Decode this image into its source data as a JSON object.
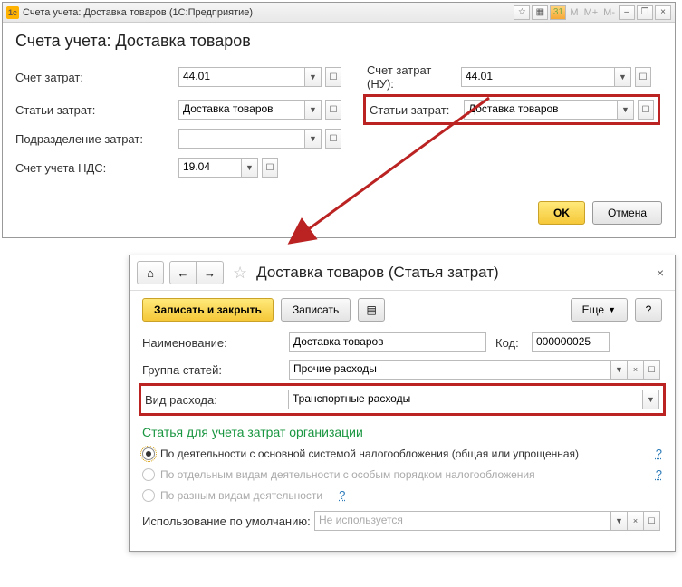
{
  "win1": {
    "titlebar": "Счета учета: Доставка товаров  (1С:Предприятие)",
    "tb_icon": "1c",
    "header": "Счета учета: Доставка товаров",
    "labels": {
      "cost_account": "Счет затрат:",
      "cost_items": "Статьи затрат:",
      "department": "Подразделение затрат:",
      "vat_account": "Счет учета НДС:",
      "cost_account_nu": "Счет затрат (НУ):",
      "cost_items_r": "Статьи затрат:"
    },
    "values": {
      "cost_account": "44.01",
      "cost_items": "Доставка товаров",
      "department": "",
      "vat_account": "19.04",
      "cost_account_nu": "44.01",
      "cost_items_r": "Доставка товаров"
    },
    "ok": "OK",
    "cancel": "Отмена",
    "top_buttons": {
      "m": "M",
      "mplus": "M+",
      "mminus": "M-"
    }
  },
  "win2": {
    "title": "Доставка товаров (Статья затрат)",
    "save_close": "Записать и закрыть",
    "save": "Записать",
    "more": "Еще",
    "labels": {
      "name": "Наименование:",
      "group": "Группа статей:",
      "expense_type": "Вид расхода:",
      "code": "Код:",
      "default_use": "Использование по умолчанию:"
    },
    "values": {
      "name": "Доставка товаров",
      "group": "Прочие расходы",
      "expense_type": "Транспортные расходы",
      "code": "000000025",
      "default_use_placeholder": "Не используется"
    },
    "section": "Статья для учета затрат организации",
    "radios": {
      "r1": "По деятельности с основной системой налогообложения (общая или упрощенная)",
      "r2": "По отдельным видам деятельности с особым порядком налогообложения",
      "r3": "По разным видам деятельности"
    },
    "help": "?"
  },
  "glyphs": {
    "dropdown": "▼",
    "open": "☐",
    "home": "⌂",
    "back": "←",
    "fwd": "→",
    "star_empty": "☆",
    "close": "×",
    "list": "▤",
    "star_a": "☆",
    "calc_a": "▦",
    "cal_a": "31",
    "min": "–",
    "window": "❐"
  }
}
